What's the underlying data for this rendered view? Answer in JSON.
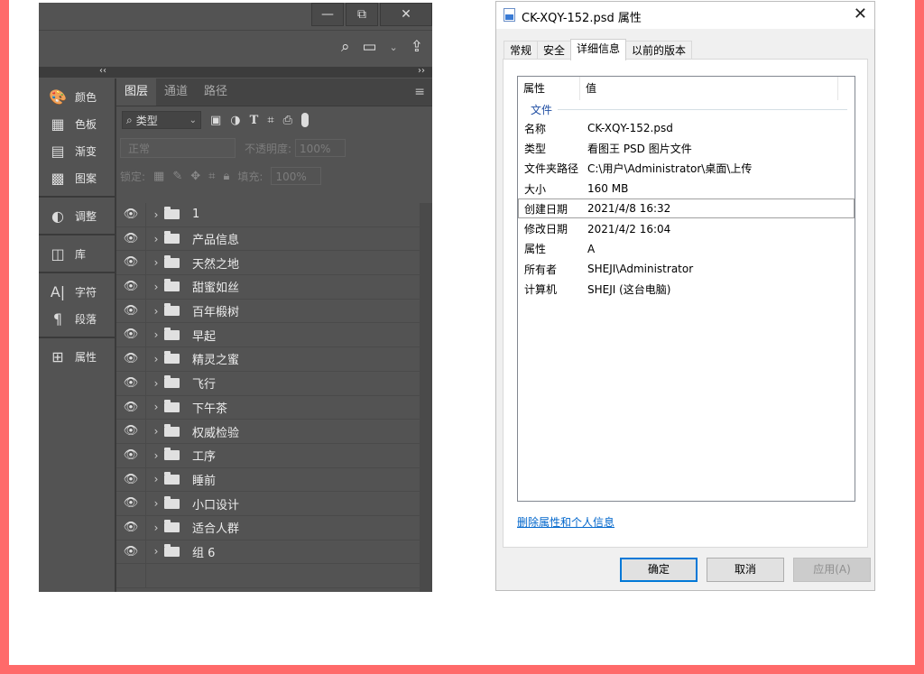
{
  "photoshop": {
    "window_buttons": {
      "minimize": "—",
      "restore": "⧉",
      "close": "✕"
    },
    "collapse": {
      "left": "‹‹",
      "right": "››"
    },
    "dock": [
      {
        "icon": "palette-icon",
        "glyph": "🎨",
        "label": "颜色"
      },
      {
        "icon": "swatches-icon",
        "glyph": "▦",
        "label": "色板"
      },
      {
        "icon": "gradient-icon",
        "glyph": "▤",
        "label": "渐变"
      },
      {
        "icon": "patterns-icon",
        "glyph": "▩",
        "label": "图案"
      },
      {
        "icon": "adjustments-icon",
        "glyph": "◐",
        "label": "调整"
      },
      {
        "icon": "libraries-icon",
        "glyph": "◫",
        "label": "库"
      },
      {
        "icon": "character-icon",
        "glyph": "A|",
        "label": "字符"
      },
      {
        "icon": "paragraph-icon",
        "glyph": "¶",
        "label": "段落"
      },
      {
        "icon": "properties-icon",
        "glyph": "⊞",
        "label": "属性"
      }
    ],
    "tabs": [
      "图层",
      "通道",
      "路径"
    ],
    "filter": {
      "label": "类型"
    },
    "blend_mode": "正常",
    "opacity_label": "不透明度:",
    "opacity_value": "100%",
    "lock_label": "锁定:",
    "fill_label": "填充:",
    "fill_value": "100%",
    "layers": [
      "1",
      "产品信息",
      "天然之地",
      "甜蜜如丝",
      "百年椴树",
      "早起",
      "精灵之蜜",
      "飞行",
      "下午茶",
      "权威检验",
      "工序",
      "睡前",
      "小口设计",
      "适合人群",
      "组 6"
    ]
  },
  "dialog": {
    "title": "CK-XQY-152.psd 属性",
    "tabs": [
      "常规",
      "安全",
      "详细信息",
      "以前的版本"
    ],
    "active_tab": "详细信息",
    "columns": {
      "property": "属性",
      "value": "值"
    },
    "group": "文件",
    "rows": [
      {
        "k": "名称",
        "v": "CK-XQY-152.psd"
      },
      {
        "k": "类型",
        "v": "看图王 PSD 图片文件"
      },
      {
        "k": "文件夹路径",
        "v": "C:\\用户\\Administrator\\桌面\\上传"
      },
      {
        "k": "大小",
        "v": "160 MB"
      },
      {
        "k": "创建日期",
        "v": "2021/4/8 16:32"
      },
      {
        "k": "修改日期",
        "v": "2021/4/2 16:04"
      },
      {
        "k": "属性",
        "v": "A"
      },
      {
        "k": "所有者",
        "v": "SHEJI\\Administrator"
      },
      {
        "k": "计算机",
        "v": "SHEJI (这台电脑)"
      }
    ],
    "remove_link": "删除属性和个人信息",
    "buttons": {
      "ok": "确定",
      "cancel": "取消",
      "apply": "应用(A)"
    }
  }
}
